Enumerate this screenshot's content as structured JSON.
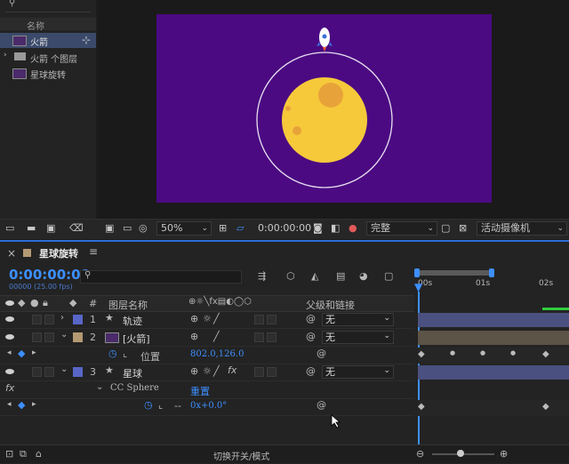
{
  "project": {
    "search_icon": "search-icon",
    "column_name": "名称",
    "items": [
      {
        "label": "火箭",
        "selected": true
      },
      {
        "label": "火箭 个图层",
        "selected": false
      },
      {
        "label": "星球旋转",
        "selected": false
      }
    ]
  },
  "viewer": {
    "zoom": "50%",
    "time": "0:00:00:00",
    "quality": "完整",
    "camera": "活动摄像机"
  },
  "timeline": {
    "comp_tab": "星球旋转",
    "timecode": "0:00:00:00",
    "fps": "00000 (25.00 fps)",
    "columns": {
      "hash": "#",
      "layer_name": "图层名称",
      "parent": "父级和链接"
    },
    "layers": [
      {
        "num": "1",
        "name": "轨迹",
        "color": "#5866c8",
        "parent": "无",
        "star": true
      },
      {
        "num": "2",
        "name": "[火箭]",
        "color": "#b49a72",
        "parent": "无",
        "star": false
      }
    ],
    "prop_position": {
      "name": "位置",
      "value": "802.0,126.0"
    },
    "layer3": {
      "num": "3",
      "name": "星球",
      "color": "#5866c8",
      "parent": "无"
    },
    "effect": {
      "label": "CC Sphere",
      "reset": "重置",
      "fx": "fx"
    },
    "rotation_value": "0x+0.0°",
    "ruler": [
      "00s",
      "01s",
      "02s"
    ],
    "toggle_label": "切换开关/模式"
  },
  "colors": {
    "accent": "#2d6dd8",
    "canvas": "#4b0a82",
    "planet": "#f6c93a"
  }
}
